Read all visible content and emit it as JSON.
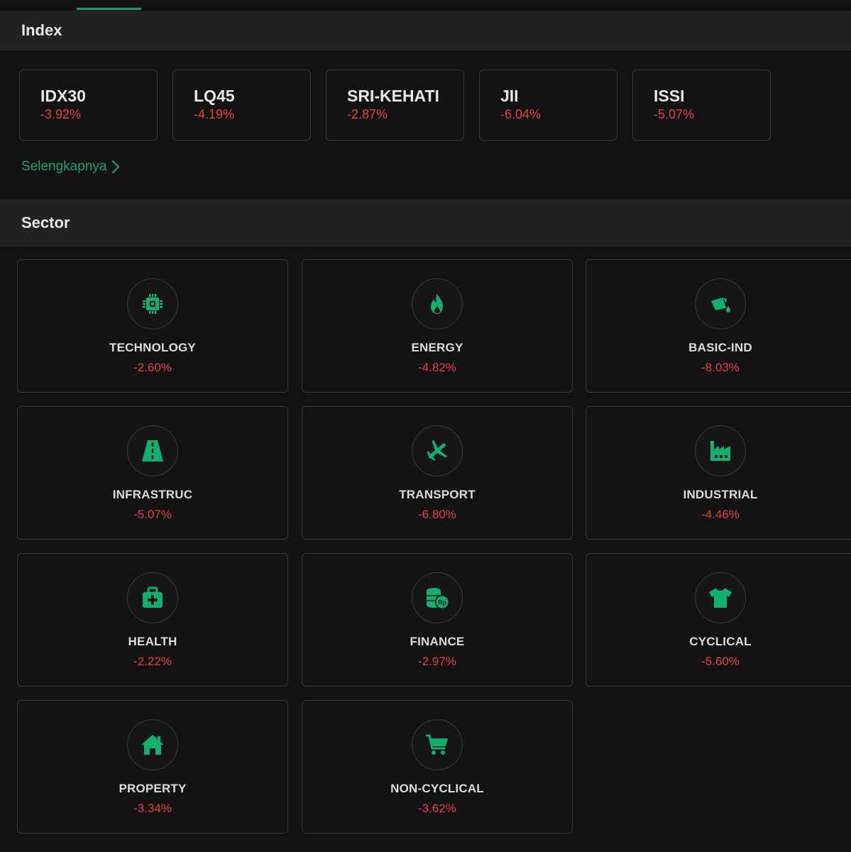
{
  "index_section": {
    "title": "Index",
    "items": [
      {
        "name": "IDX30",
        "change": "-3.92%"
      },
      {
        "name": "LQ45",
        "change": "-4.19%"
      },
      {
        "name": "SRI-KEHATI",
        "change": "-2.87%"
      },
      {
        "name": "JII",
        "change": "-6.04%"
      },
      {
        "name": "ISSI",
        "change": "-5.07%"
      }
    ],
    "more_label": "Selengkapnya"
  },
  "sector_section": {
    "title": "Sector",
    "items": [
      {
        "name": "TECHNOLOGY",
        "change": "-2.60%",
        "icon": "chip-icon"
      },
      {
        "name": "ENERGY",
        "change": "-4.82%",
        "icon": "flame-icon"
      },
      {
        "name": "BASIC-IND",
        "change": "-8.03%",
        "icon": "paint-bucket-icon"
      },
      {
        "name": "INFRASTRUC",
        "change": "-5.07%",
        "icon": "road-icon"
      },
      {
        "name": "TRANSPORT",
        "change": "-6.80%",
        "icon": "airplane-icon"
      },
      {
        "name": "INDUSTRIAL",
        "change": "-4.46%",
        "icon": "factory-icon"
      },
      {
        "name": "HEALTH",
        "change": "-2.22%",
        "icon": "medical-kit-icon"
      },
      {
        "name": "FINANCE",
        "change": "-2.97%",
        "icon": "coins-icon"
      },
      {
        "name": "CYCLICAL",
        "change": "-5.60%",
        "icon": "tshirt-icon"
      },
      {
        "name": "PROPERTY",
        "change": "-3.34%",
        "icon": "house-icon"
      },
      {
        "name": "NON-CYCLICAL",
        "change": "-3.62%",
        "icon": "cart-icon"
      }
    ]
  },
  "colors": {
    "accent": "#0fa36b",
    "negative": "#e5443c",
    "background": "#121212",
    "header_bg": "#222222"
  }
}
